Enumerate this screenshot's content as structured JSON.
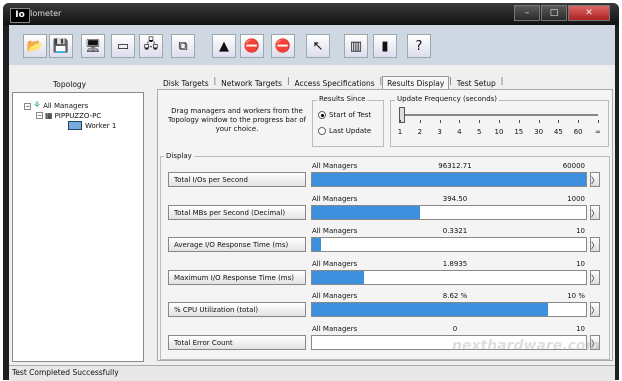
{
  "window": {
    "app_icon_text": "Io",
    "title": "Iometer",
    "controls": [
      "–",
      "□",
      "✕"
    ]
  },
  "toolbar": {
    "buttons": [
      {
        "name": "open-config-icon",
        "glyph": "📂"
      },
      {
        "name": "save-config-icon",
        "glyph": "💾"
      },
      {
        "name": "new-manager-icon",
        "glyph": "🖥"
      },
      {
        "name": "new-disk-worker-icon",
        "glyph": "▭"
      },
      {
        "name": "new-network-worker-icon",
        "glyph": "🖧"
      },
      {
        "name": "copy-worker-icon",
        "glyph": "⧉"
      },
      {
        "name": "start-tests-icon",
        "glyph": "▲"
      },
      {
        "name": "stop-icon",
        "glyph": "⛔"
      },
      {
        "name": "stop-all-icon",
        "glyph": "⛔"
      },
      {
        "name": "reset-workers-icon",
        "glyph": "↖"
      },
      {
        "name": "exit-icon",
        "glyph": "▥"
      },
      {
        "name": "quit-icon",
        "glyph": "▮"
      },
      {
        "name": "help-icon",
        "glyph": "?"
      }
    ]
  },
  "topology": {
    "label": "Topology",
    "tree": {
      "root": "All Managers",
      "manager": "PIPPUZZO-PC",
      "worker": "Worker 1"
    }
  },
  "tabs": [
    "Disk Targets",
    "Network Targets",
    "Access Specifications",
    "Results Display",
    "Test Setup"
  ],
  "active_tab": "Results Display",
  "results_display": {
    "hint": "Drag managers and workers from the Topology window to the progress bar of your choice.",
    "results_since": {
      "label": "Results Since",
      "options": [
        "Start of Test",
        "Last Update"
      ],
      "selected": "Start of Test"
    },
    "update_frequency": {
      "label": "Update Frequency (seconds)",
      "ticks": [
        "1",
        "2",
        "3",
        "4",
        "5",
        "10",
        "15",
        "30",
        "45",
        "60",
        "∞"
      ],
      "selected": "1"
    },
    "display_label": "Display",
    "metrics": [
      {
        "label": "Total I/Os per Second",
        "target": "All Managers",
        "value": "96312.71",
        "max": "60000",
        "fill": 1.0
      },
      {
        "label": "Total MBs per Second (Decimal)",
        "target": "All Managers",
        "value": "394.50",
        "max": "1000",
        "fill": 0.3945
      },
      {
        "label": "Average I/O Response Time (ms)",
        "target": "All Managers",
        "value": "0.3321",
        "max": "10",
        "fill": 0.033
      },
      {
        "label": "Maximum I/O Response Time (ms)",
        "target": "All Managers",
        "value": "1.8935",
        "max": "10",
        "fill": 0.189
      },
      {
        "label": "% CPU Utilization (total)",
        "target": "All Managers",
        "value": "8.62 %",
        "max": "10 %",
        "fill": 0.862
      },
      {
        "label": "Total Error Count",
        "target": "All Managers",
        "value": "0",
        "max": "10",
        "fill": 0
      }
    ],
    "arrow_glyph": "〉"
  },
  "watermark": "nexthardware.com",
  "status": "Test Completed Successfully",
  "colors": {
    "bar": "#3f8fdf",
    "toolbar": "#cfd8e2"
  }
}
